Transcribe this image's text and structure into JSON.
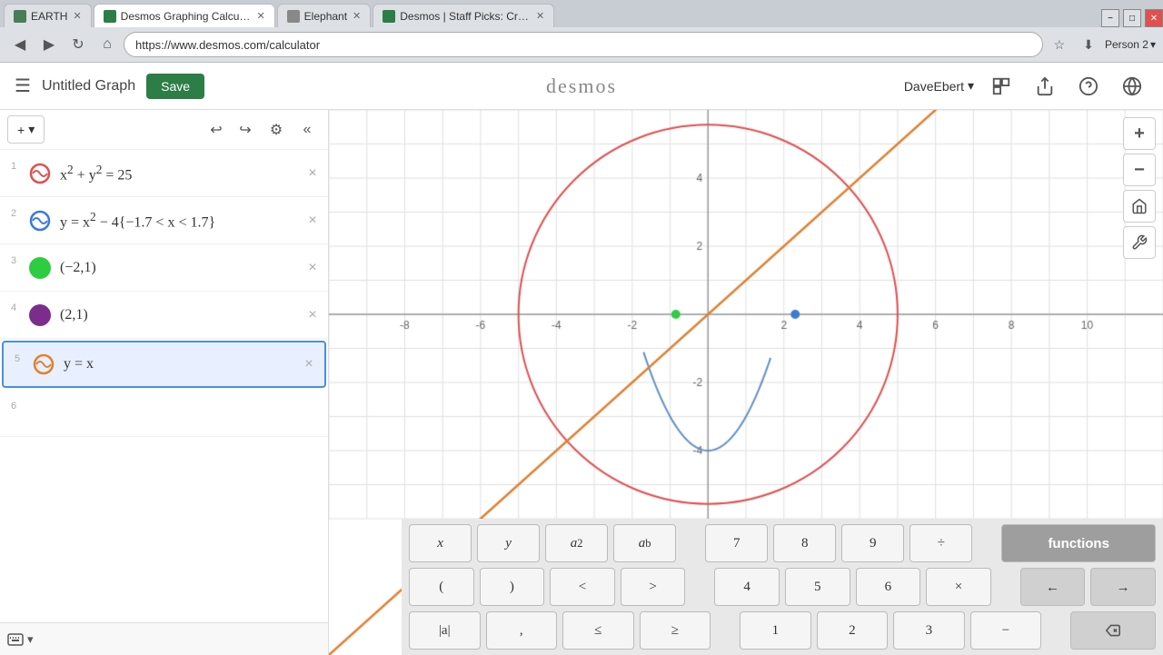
{
  "browser": {
    "tabs": [
      {
        "label": "EARTH",
        "active": false,
        "color": "#4a7c59"
      },
      {
        "label": "Desmos Graphing Calculator",
        "active": true,
        "color": "#2d7d46"
      },
      {
        "label": "Elephant",
        "active": false,
        "color": "#888"
      },
      {
        "label": "Desmos | Staff Picks: Creati...",
        "active": false,
        "color": "#2d7d46"
      }
    ],
    "url": "https://www.desmos.com/calculator",
    "person": "Person 2"
  },
  "topbar": {
    "graph_title": "Untitled Graph",
    "save_label": "Save",
    "logo": "desmos",
    "user": "DaveEbert"
  },
  "sidebar": {
    "toolbar": {
      "add_label": "+▾",
      "undo": "↩",
      "redo": "↪"
    },
    "expressions": [
      {
        "num": "1",
        "text": "x² + y² = 25",
        "icon_color": "#e05050",
        "icon_type": "wave"
      },
      {
        "num": "2",
        "text": "y = x² − 4{−1.7 < x < 1.7}",
        "icon_color": "#3a7bd5",
        "icon_type": "wave2"
      },
      {
        "num": "3",
        "text": "(−2,1)",
        "icon_color": "#2ecc40",
        "icon_type": "dot"
      },
      {
        "num": "4",
        "text": "(2,1)",
        "icon_color": "#7b2d8b",
        "icon_type": "dot"
      },
      {
        "num": "5",
        "text": "y = x",
        "icon_color": "#e08030",
        "icon_type": "wave2",
        "active": true
      },
      {
        "num": "6",
        "text": "",
        "icon_color": "#888",
        "icon_type": "none"
      }
    ]
  },
  "keyboard": {
    "row1": [
      "x",
      "y",
      "a²",
      "aᵇ"
    ],
    "row2": [
      "(",
      ")",
      "<",
      ">"
    ],
    "row3": [
      "|a|",
      ",",
      "≤",
      "≥"
    ],
    "numpad_row1": [
      "7",
      "8",
      "9",
      "÷"
    ],
    "numpad_row2": [
      "4",
      "5",
      "6",
      "×"
    ],
    "numpad_row3": [
      "1",
      "2",
      "3",
      "−"
    ],
    "functions_label": "functions",
    "left_arrow": "←",
    "right_arrow": "→",
    "backspace": "⌫"
  },
  "graph": {
    "x_labels": [
      "-8",
      "-6",
      "-4",
      "-2",
      "",
      "2",
      "4",
      "6",
      "8",
      "10"
    ],
    "y_labels": [
      "4",
      "2",
      "-2",
      "-4"
    ],
    "colors": {
      "circle": "#e05050",
      "parabola": "#6090c8",
      "line": "#e08030",
      "grid": "#e0e0e0",
      "axis": "#999"
    }
  }
}
